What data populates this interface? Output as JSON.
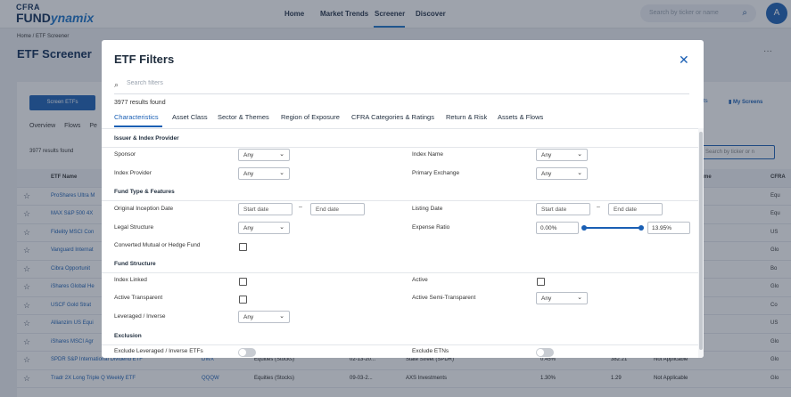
{
  "app": {
    "logo_top": "CFRA",
    "logo_main": "FUND",
    "logo_italic": "ynamix",
    "nav": [
      "Home",
      "Market Trends",
      "Screener",
      "Discover"
    ],
    "search_placeholder": "Search by ticker or name",
    "avatar_letter": "A"
  },
  "page": {
    "breadcrumb": "Home  /  ETF Screener",
    "title": "ETF Screener",
    "more": "···",
    "screen_button": "Screen ETFs",
    "subtabs": [
      "Overview",
      "Flows",
      "Pe"
    ],
    "right_link_1": "ts",
    "right_link_2": "My Screens",
    "results": "3977 results found",
    "table_search": "Search by ticker or n",
    "col_name": "ETF Name",
    "col_right": "me",
    "col_last": "CFRA",
    "rows": [
      {
        "name": "ProShares Ultra M",
        "last": "Equ"
      },
      {
        "name": "MAX S&P 500 4X",
        "last": "Equ"
      },
      {
        "name": "Fidelity MSCI Con",
        "last": "US"
      },
      {
        "name": "Vanguard Internat",
        "last": "Glo"
      },
      {
        "name": "Cibra Opportunit",
        "last": "Bo"
      },
      {
        "name": "iShares Global He",
        "last": "Glo"
      },
      {
        "name": "USCF Gold Strat",
        "last": "Co"
      },
      {
        "name": "Allianzim US Equi",
        "last": "US"
      },
      {
        "name": "iShares MSCI Agr",
        "last": "Glo"
      },
      {
        "name": "SPDR S&P International Dividend ETF",
        "ticker": "DWX",
        "cat": "Equities (Stocks)",
        "date": "02-13-20...",
        "issuer": "State Street (SPDR)",
        "ratio": "0.45%",
        "aum": "382.21",
        "rating": "Not Applicable",
        "last": "Glo"
      },
      {
        "name": "Tradr 2X Long Triple Q Weekly ETF",
        "ticker": "QQQW",
        "cat": "Equities (Stocks)",
        "date": "09-03-2...",
        "issuer": "AXS Investments",
        "ratio": "1.30%",
        "aum": "1.29",
        "rating": "Not Applicable",
        "last": "Glo"
      }
    ]
  },
  "modal": {
    "title": "ETF Filters",
    "search_placeholder": "Search filters",
    "results": "3977 results found",
    "tabs": [
      "Characteristics",
      "Asset Class",
      "Sector & Themes",
      "Region of Exposure",
      "CFRA Categories & Ratings",
      "Return & Risk",
      "Assets & Flows"
    ],
    "active_tab": "Characteristics",
    "sections": {
      "issuer": "Issuer & Index Provider",
      "fund_type": "Fund Type & Features",
      "structure": "Fund Structure",
      "exclusion": "Exclusion"
    },
    "labels": {
      "sponsor": "Sponsor",
      "index_name": "Index Name",
      "index_provider": "Index Provider",
      "primary_exchange": "Primary Exchange",
      "inception": "Original Inception Date",
      "listing": "Listing Date",
      "legal": "Legal Structure",
      "expense": "Expense Ratio",
      "converted": "Converted Mutual or Hedge Fund",
      "index_linked": "Index Linked",
      "active": "Active",
      "active_transparent": "Active Transparent",
      "active_semi": "Active Semi-Transparent",
      "leveraged": "Leveraged / Inverse",
      "exclude_lev": "Exclude Leveraged / Inverse ETFs",
      "exclude_etn": "Exclude ETNs"
    },
    "any": "Any",
    "start_date": "Start date",
    "end_date": "End date",
    "dash": "–",
    "expense_min": "0.00%",
    "expense_max": "13.95%"
  }
}
